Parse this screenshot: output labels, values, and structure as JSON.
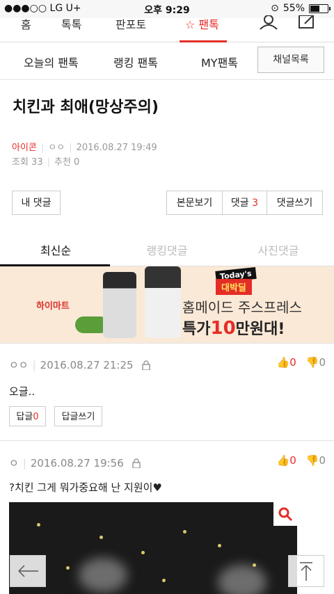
{
  "status_bar": {
    "carrier": "●●●○○ LG U+",
    "time": "오후 9:29",
    "battery": "55%"
  },
  "gnb": {
    "tabs": [
      "홈",
      "톡톡",
      "판포토",
      "☆ 팬톡"
    ],
    "active_tab": "☆ 팬톡"
  },
  "subnav": {
    "items": [
      "오늘의 팬톡",
      "랭킹 팬톡",
      "MY팬톡"
    ],
    "channel_button": "채널목록"
  },
  "post": {
    "title": "치킨과 최애(망상주의)",
    "author": "아이콘",
    "nickname": "ㅇㅇ",
    "datetime": "2016.08.27 19:49",
    "views_label": "조회 33",
    "recommend_label": "추천 0"
  },
  "actions": {
    "my_comments": "내 댓글",
    "view_body": "본문보기",
    "comments_label": "댓글",
    "comments_count": "3",
    "write_comment": "댓글쓰기"
  },
  "comment_tabs": [
    "최신순",
    "랭킹댓글",
    "사진댓글"
  ],
  "banner": {
    "brand": "하이마트",
    "badge_top": "Today's",
    "badge_main": "대박딜",
    "line1": "홈메이드 주스프레스",
    "line2_pre": "특가",
    "line2_big": "10",
    "line2_post": "만원대!"
  },
  "comments": [
    {
      "author": "ㅇㅇ",
      "datetime": "2016.08.27 21:25",
      "up": "0",
      "down": "0",
      "text": "오글..",
      "reply_label": "답글",
      "reply_count": "0",
      "write_reply": "답글쓰기"
    },
    {
      "author": "ㅇ",
      "datetime": "2016.08.27 19:56",
      "up": "0",
      "down": "0",
      "text": "?치킨 그게 뭐가중요해 난 지원이♥"
    }
  ],
  "colors": {
    "accent": "#e52d27",
    "border": "#cccccc",
    "muted": "#999999"
  }
}
